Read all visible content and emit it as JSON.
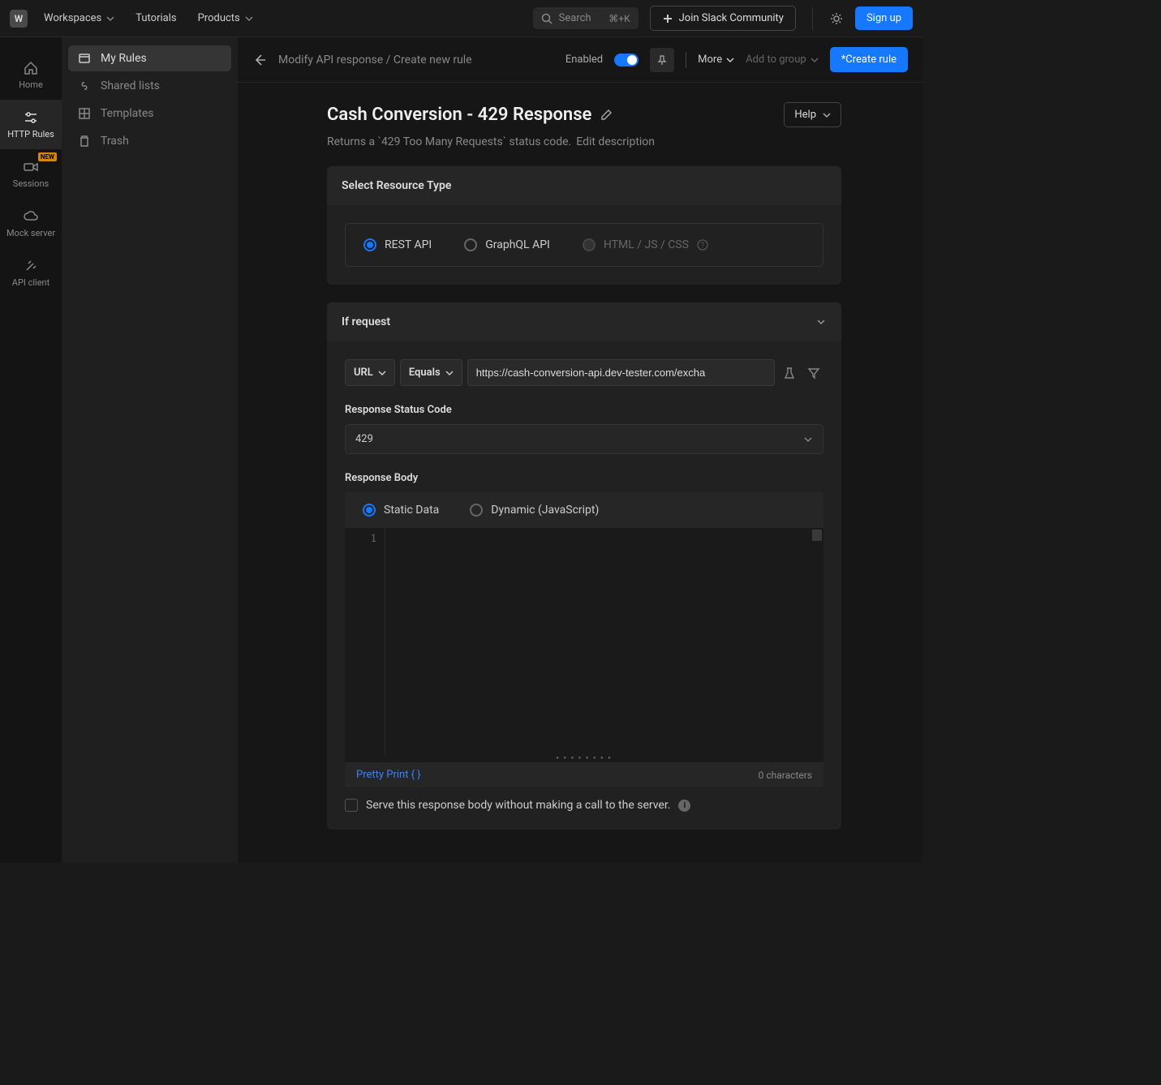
{
  "topbar": {
    "workspace_letter": "W",
    "workspaces": "Workspaces",
    "tutorials": "Tutorials",
    "products": "Products",
    "search_placeholder": "Search",
    "search_shortcut": "⌘+K",
    "join_slack": "Join Slack Community",
    "signup": "Sign up"
  },
  "leftnav": {
    "home": "Home",
    "http_rules": "HTTP Rules",
    "sessions": "Sessions",
    "sessions_badge": "NEW",
    "mock_server": "Mock server",
    "api_client": "API client"
  },
  "sidebar": {
    "my_rules": "My Rules",
    "shared_lists": "Shared lists",
    "templates": "Templates",
    "trash": "Trash"
  },
  "toolbar": {
    "breadcrumb": "Modify API response / Create new rule",
    "enabled": "Enabled",
    "more": "More",
    "add_to_group": "Add to group",
    "create_rule": "*Create rule"
  },
  "page": {
    "title": "Cash Conversion - 429 Response",
    "description": "Returns a `429 Too Many Requests` status code.",
    "edit_description": "Edit description",
    "help": "Help"
  },
  "resource": {
    "label": "Select Resource Type",
    "rest": "REST API",
    "graphql": "GraphQL API",
    "html": "HTML / JS / CSS"
  },
  "request": {
    "label": "If request",
    "url_dd": "URL",
    "equals_dd": "Equals",
    "url_value": "https://cash-conversion-api.dev-tester.com/excha",
    "status_label": "Response Status Code",
    "status_value": "429",
    "body_label": "Response Body",
    "static_data": "Static Data",
    "dynamic": "Dynamic (JavaScript)",
    "line1": "1",
    "pretty_print": "Pretty Print { }",
    "char_count": "0 characters",
    "serve_text": "Serve this response body without making a call to the server."
  }
}
